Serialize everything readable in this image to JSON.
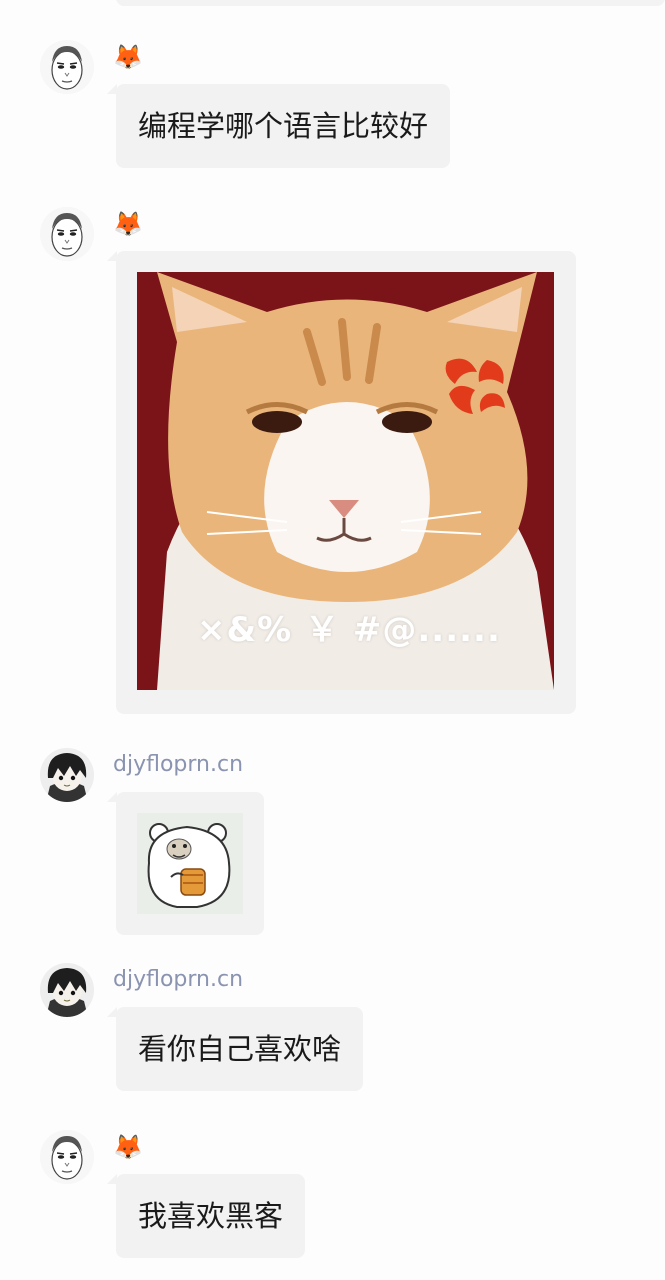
{
  "messages": [
    {
      "sender": "🦊",
      "type": "text",
      "text": "编程学哪个语言比较好"
    },
    {
      "sender": "🦊",
      "type": "image",
      "image": "angry-cat-meme",
      "caption": "×&% ￥ #@......"
    },
    {
      "sender": "djyfloprn.cn",
      "type": "image",
      "image": "bear-eating-sticker"
    },
    {
      "sender": "djyfloprn.cn",
      "type": "text",
      "text": "看你自己喜欢啥"
    },
    {
      "sender": "🦊",
      "type": "text",
      "text": "我喜欢黑客"
    }
  ],
  "colors": {
    "background": "#fdfdfd",
    "bubble": "#f2f2f2",
    "sender_name": "#8a93b0",
    "meme_background": "#7a1418"
  }
}
